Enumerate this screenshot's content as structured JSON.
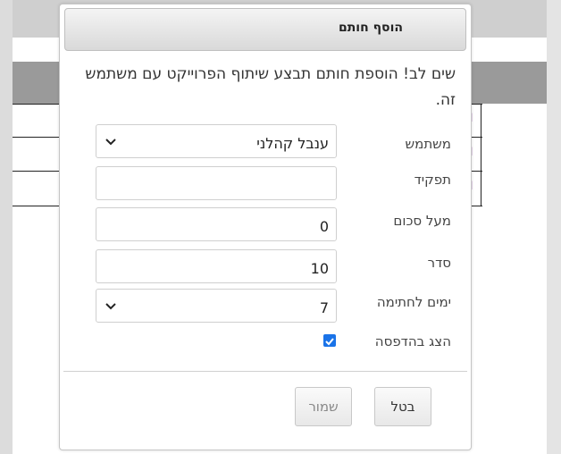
{
  "dialog": {
    "title": "הוסף חותם",
    "notice": "שים לב! הוספת חותם תבצע שיתוף הפרוייקט עם משתמש זה."
  },
  "form": {
    "user": {
      "label": "משתמש",
      "value": "ענבל קהלני"
    },
    "role": {
      "label": "תפקיד",
      "value": ""
    },
    "above_amount": {
      "label": "מעל סכום",
      "value": "0"
    },
    "order": {
      "label": "סדר",
      "value": "10"
    },
    "days_to_sign": {
      "label": "ימים לחתימה",
      "value": "7"
    },
    "show_in_print": {
      "label": "הצג בהדפסה",
      "checked": true
    }
  },
  "buttons": {
    "save": "שמור",
    "cancel": "בטל"
  },
  "background": {
    "marks": [
      "l",
      "l",
      "l"
    ]
  },
  "colors": {
    "accent": "#1a73e8",
    "header_grey": "#9a9a9a"
  }
}
